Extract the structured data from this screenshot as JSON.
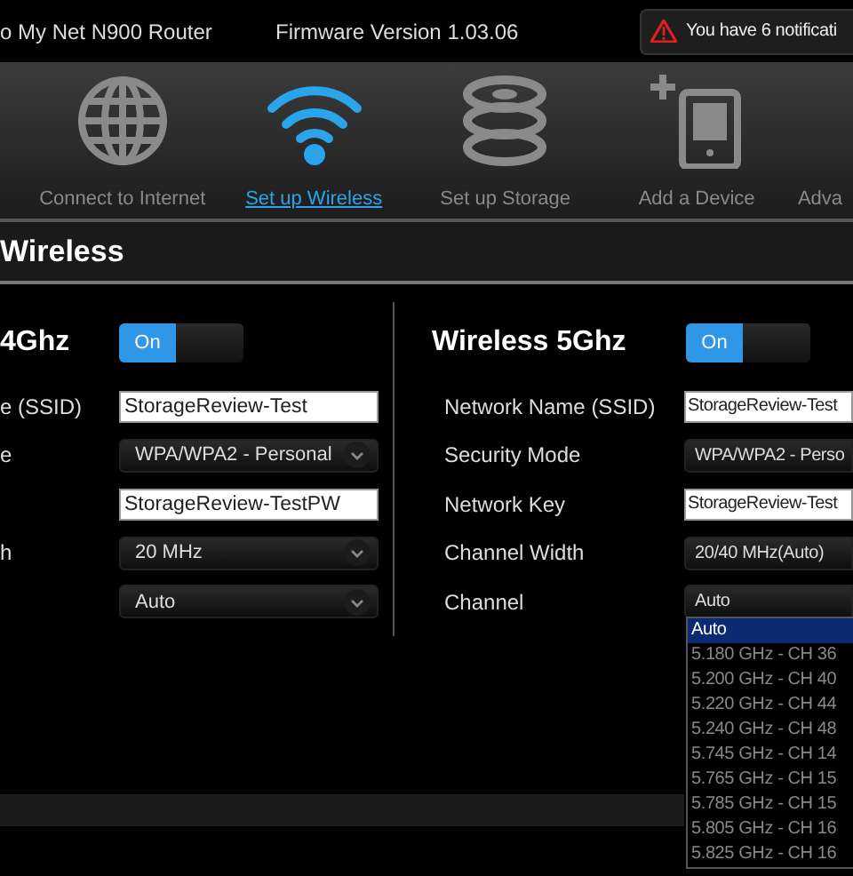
{
  "header": {
    "title": "o My Net N900 Router",
    "firmware": "Firmware Version 1.03.06",
    "notification": "You have 6 notificati"
  },
  "nav": [
    {
      "label": "Connect to Internet",
      "selected": false
    },
    {
      "label": "Set up Wireless",
      "selected": true
    },
    {
      "label": "Set up Storage",
      "selected": false
    },
    {
      "label": "Add a Device",
      "selected": false
    },
    {
      "label": "Adva",
      "selected": false
    }
  ],
  "section_title": "Wireless",
  "bands": [
    {
      "title": "4Ghz",
      "toggle": {
        "label": "On",
        "on": true
      },
      "fields": [
        {
          "label": "e (SSID)",
          "kind": "text",
          "value": "StorageReview-Test"
        },
        {
          "label": "e",
          "kind": "select",
          "value": "WPA/WPA2 - Personal"
        },
        {
          "kind": "text",
          "value": "StorageReview-TestPW"
        },
        {
          "label": "h",
          "kind": "select",
          "value": "20 MHz"
        },
        {
          "kind": "select",
          "value": "Auto"
        }
      ]
    },
    {
      "title": "Wireless 5Ghz",
      "toggle": {
        "label": "On",
        "on": true
      },
      "fields": [
        {
          "label": "Network Name (SSID)",
          "kind": "text",
          "value": "StorageReview-Test"
        },
        {
          "label": "Security Mode",
          "kind": "select",
          "value": "WPA/WPA2 - Perso"
        },
        {
          "label": "Network Key",
          "kind": "text",
          "value": "StorageReview-Test"
        },
        {
          "label": "Channel Width",
          "kind": "select",
          "value": "20/40 MHz(Auto)"
        },
        {
          "label": "Channel",
          "kind": "select",
          "value": "Auto",
          "options": [
            {
              "label": "Auto",
              "selected": true
            },
            {
              "label": "5.180 GHz - CH 36",
              "selected": false
            },
            {
              "label": "5.200 GHz - CH 40",
              "selected": false
            },
            {
              "label": "5.220 GHz - CH 44",
              "selected": false
            },
            {
              "label": "5.240 GHz - CH 48",
              "selected": false
            },
            {
              "label": "5.745 GHz - CH 14",
              "selected": false
            },
            {
              "label": "5.765 GHz - CH 15",
              "selected": false
            },
            {
              "label": "5.785 GHz - CH 15",
              "selected": false
            },
            {
              "label": "5.805 GHz - CH 16",
              "selected": false
            },
            {
              "label": "5.825 GHz - CH 16",
              "selected": false
            }
          ]
        }
      ]
    }
  ]
}
